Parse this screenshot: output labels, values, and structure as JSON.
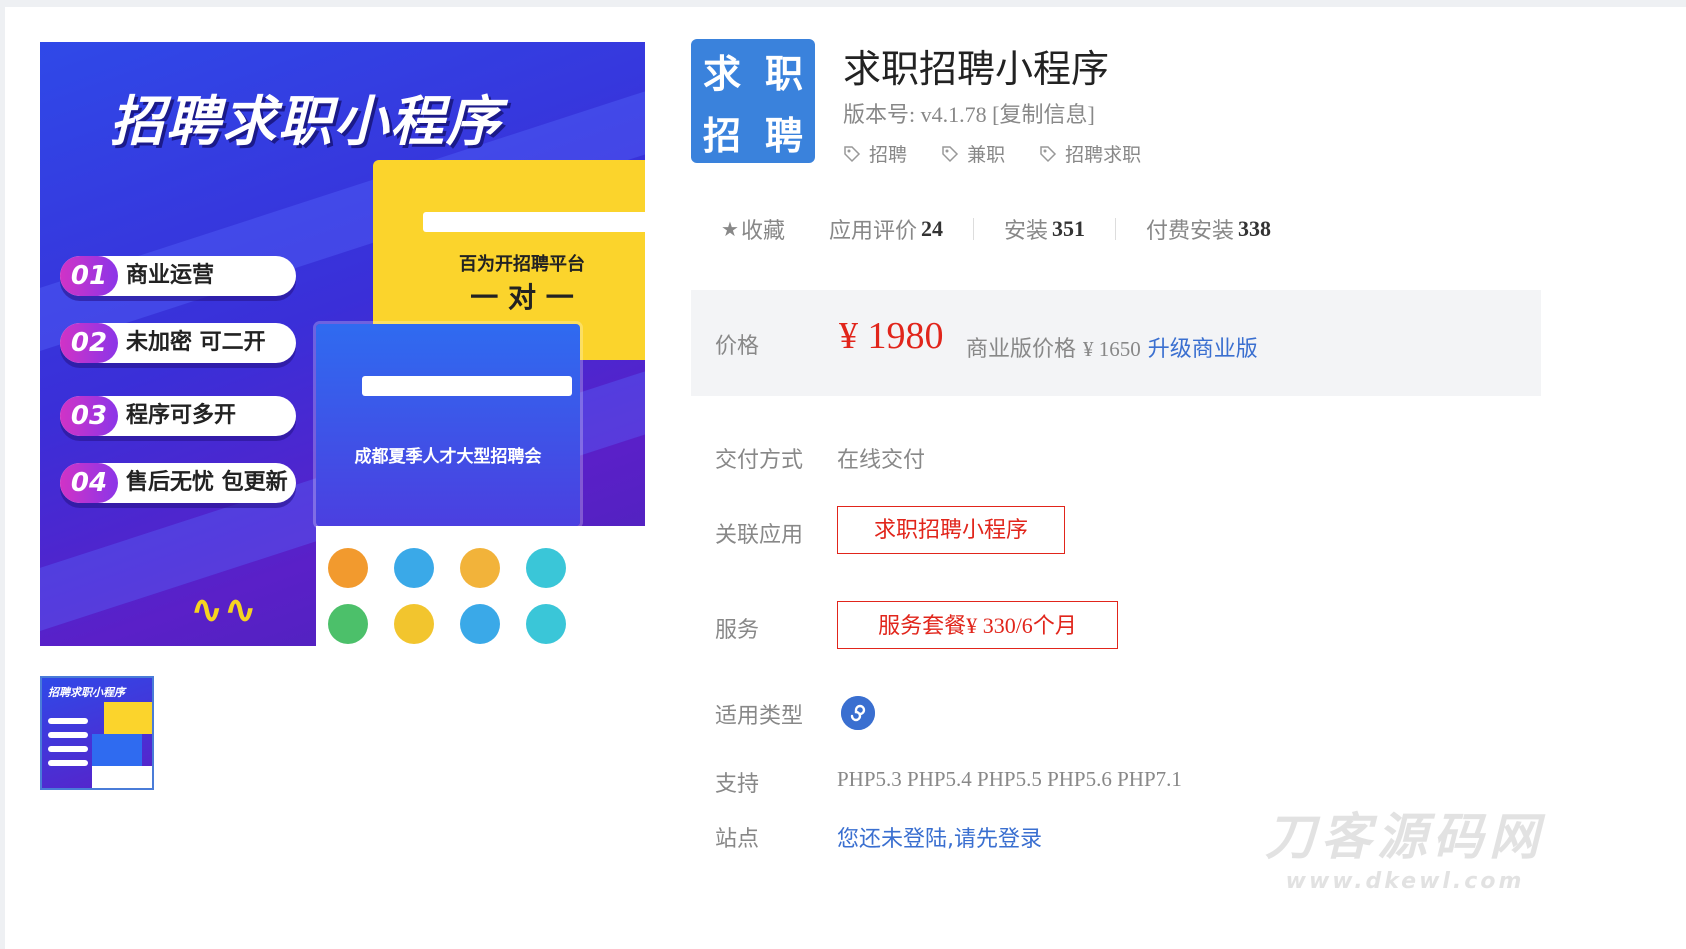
{
  "gallery": {
    "hero_title": "招聘求职小程序",
    "features": [
      {
        "num": "01",
        "text": "商业运营"
      },
      {
        "num": "02",
        "text": "未加密 可二开"
      },
      {
        "num": "03",
        "text": "程序可多开"
      },
      {
        "num": "04",
        "text": "售后无忧 包更新"
      }
    ],
    "yellow_slogan": "百为开招聘平台",
    "yellow_slogan2": "一 对 一",
    "blue_event": "成都夏季人才大型招聘会",
    "thumb_title": "招聘求职小程序"
  },
  "app": {
    "logo_chars": [
      "求",
      "职",
      "招",
      "聘"
    ],
    "title": "求职招聘小程序",
    "version_label": "版本号:",
    "version_value": "v4.1.78",
    "copy_label": "[复制信息]",
    "tags": [
      "招聘",
      "兼职",
      "招聘求职"
    ]
  },
  "stats": {
    "favorite_label": "收藏",
    "rating_label": "应用评价",
    "rating_count": "24",
    "install_label": "安装",
    "install_count": "351",
    "paid_install_label": "付费安装",
    "paid_install_count": "338"
  },
  "price": {
    "label": "价格",
    "main": "¥ 1980",
    "business_label": "商业版价格",
    "business_price": "¥ 1650",
    "upgrade_link": "升级商业版"
  },
  "details": {
    "delivery_label": "交付方式",
    "delivery_value": "在线交付",
    "related_label": "关联应用",
    "related_app": "求职招聘小程序",
    "service_label": "服务",
    "service_prefix": "服务套餐",
    "service_price": "¥ 330/6",
    "service_suffix": "个月",
    "type_label": "适用类型",
    "support_label": "支持",
    "support_value": "PHP5.3 PHP5.4 PHP5.5 PHP5.6 PHP7.1",
    "site_label": "站点",
    "site_value": "您还未登陆,请先登录"
  },
  "watermark": {
    "line1": "刀客源码网",
    "line2": "www.dkewl.com"
  },
  "colors": {
    "accent_red": "#e1251b",
    "link_blue": "#3a6fd0",
    "logo_blue": "#3a82dc"
  }
}
